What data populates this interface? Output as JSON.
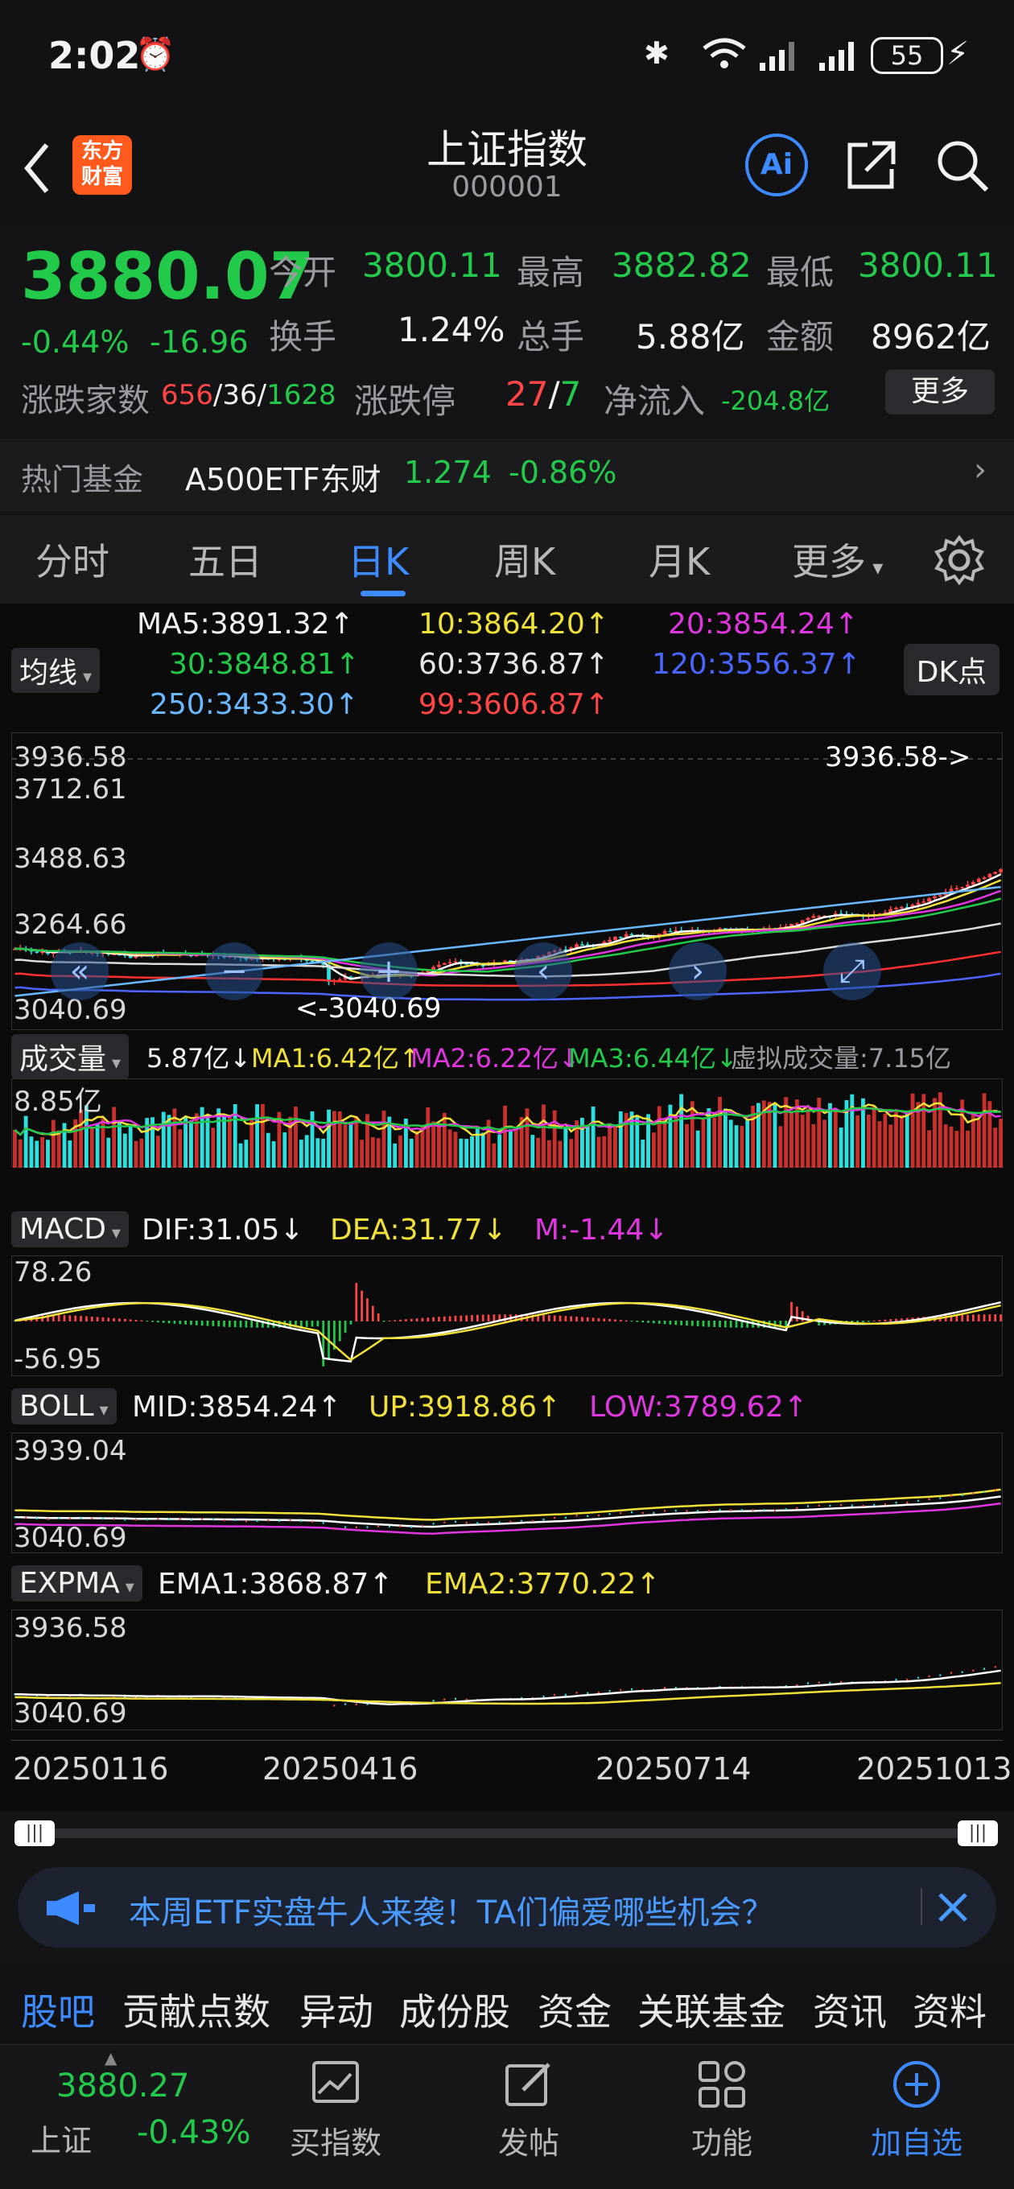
{
  "status": {
    "time": "2:02",
    "battery": "55"
  },
  "header": {
    "title": "上证指数",
    "code": "000001",
    "logo_text_1": "东方",
    "logo_text_2": "财富",
    "ai_label": "Ai"
  },
  "quote": {
    "price": "3880.07",
    "change_pct": "-0.44%",
    "change": "-16.96",
    "open_label": "今开",
    "open": "3800.11",
    "high_label": "最高",
    "high": "3882.82",
    "low_label": "最低",
    "low": "3800.11",
    "turnover_label": "换手",
    "turnover": "1.24%",
    "vol_label": "总手",
    "vol": "5.88亿",
    "amount_label": "金额",
    "amount": "8962亿",
    "updown_label": "涨跌家数",
    "up": "656",
    "flat": "/36/",
    "down": "1628",
    "limit_label": "涨跌停",
    "limit_up": "27",
    "limit_sep": "/",
    "limit_down": "7",
    "inflow_label": "净流入",
    "inflow": "-204.8亿",
    "more": "更多"
  },
  "fund": {
    "label": "热门基金",
    "name": "A500ETF东财",
    "price": "1.274",
    "pct": "-0.86%"
  },
  "tabs": [
    "分时",
    "五日",
    "日K",
    "周K",
    "月K",
    "更多"
  ],
  "active_tab": "日K",
  "ma": {
    "selector": "均线",
    "ma5": "MA5:3891.32↑",
    "ma10": "10:3864.20↑",
    "ma20": "20:3854.24↑",
    "ma30": "30:3848.81↑",
    "ma60": "60:3736.87↑",
    "ma120": "120:3556.37↑",
    "ma250": "250:3433.30↑",
    "ma99": "99:3606.87↑",
    "dk": "DK点"
  },
  "kline": {
    "y_top": "3936.58",
    "y2": "3712.61",
    "y3": "3488.63",
    "y4": "3264.66",
    "y_bottom": "3040.69",
    "max_marker": "3936.58->",
    "min_marker": "<-3040.69"
  },
  "volume": {
    "selector": "成交量",
    "v": "5.87亿↓",
    "ma1": "MA1:6.42亿↑",
    "ma2": "MA2:6.22亿↓",
    "ma3": "MA3:6.44亿↓",
    "virtual": "虚拟成交量:7.15亿",
    "ymax": "8.85亿"
  },
  "macd": {
    "selector": "MACD",
    "dif": "DIF:31.05↓",
    "dea": "DEA:31.77↓",
    "m": "M:-1.44↓",
    "ymax": "78.26",
    "ymin": "-56.95"
  },
  "boll": {
    "selector": "BOLL",
    "mid": "MID:3854.24↑",
    "up": "UP:3918.86↑",
    "low": "LOW:3789.62↑",
    "ymax": "3939.04",
    "ymin": "3040.69"
  },
  "expma": {
    "selector": "EXPMA",
    "ema1": "EMA1:3868.87↑",
    "ema2": "EMA2:3770.22↑",
    "ymax": "3936.58",
    "ymin": "3040.69"
  },
  "dates": [
    "20250116",
    "20250416",
    "20250714",
    "20251013"
  ],
  "banner": {
    "text": "本周ETF实盘牛人来袭！TA们偏爱哪些机会？"
  },
  "bottom_tabs": [
    "股吧",
    "贡献点数",
    "异动",
    "成份股",
    "资金",
    "关联基金",
    "资讯",
    "资料"
  ],
  "bottom_bar": {
    "index_price": "3880.27",
    "index_name": "上证",
    "index_pct": "-0.43%",
    "items": [
      "买指数",
      "发帖",
      "功能",
      "加自选"
    ]
  },
  "colors": {
    "up": "#ff4545",
    "down": "#22c94a",
    "accent": "#3d8bff"
  }
}
